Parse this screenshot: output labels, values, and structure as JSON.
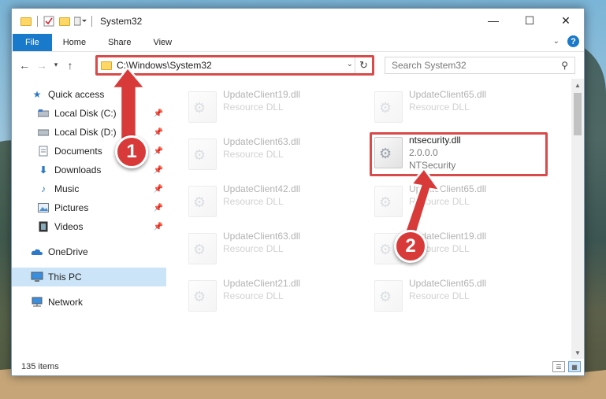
{
  "window": {
    "title": "System32",
    "controls": {
      "minimize": "—",
      "maximize": "☐",
      "close": "✕"
    }
  },
  "ribbon": {
    "tabs": [
      {
        "label": "File"
      },
      {
        "label": "Home"
      },
      {
        "label": "Share"
      },
      {
        "label": "View"
      }
    ]
  },
  "address": {
    "path": "C:\\Windows\\System32",
    "search_placeholder": "Search System32"
  },
  "sidebar": {
    "items": [
      {
        "label": "Quick access",
        "icon": "star-icon"
      },
      {
        "label": "Local Disk (C:)",
        "icon": "drive-icon",
        "pinned": true
      },
      {
        "label": "Local Disk (D:)",
        "icon": "drive-icon",
        "pinned": true
      },
      {
        "label": "Documents",
        "icon": "documents-icon",
        "pinned": true
      },
      {
        "label": "Downloads",
        "icon": "download-icon",
        "pinned": true
      },
      {
        "label": "Music",
        "icon": "music-icon",
        "pinned": true
      },
      {
        "label": "Pictures",
        "icon": "pictures-icon",
        "pinned": true
      },
      {
        "label": "Videos",
        "icon": "videos-icon",
        "pinned": true
      },
      {
        "label": "OneDrive",
        "icon": "cloud-icon"
      },
      {
        "label": "This PC",
        "icon": "computer-icon",
        "selected": true
      },
      {
        "label": "Network",
        "icon": "network-icon"
      }
    ]
  },
  "files": {
    "left": [
      {
        "name": "UpdateClient19.dll",
        "type": "Resource DLL"
      },
      {
        "name": "UpdateClient63.dll",
        "type": "Resource DLL"
      },
      {
        "name": "UpdateClient42.dll",
        "type": "Resource DLL"
      },
      {
        "name": "UpdateClient63.dll",
        "type": "Resource DLL"
      },
      {
        "name": "UpdateClient21.dll",
        "type": "Resource DLL"
      }
    ],
    "right": [
      {
        "name": "UpdateClient65.dll",
        "type": "Resource DLL"
      },
      {
        "name": "ntsecurity.dll",
        "version": "2.0.0.0",
        "company": "NTSecurity"
      },
      {
        "name": "UpdateClient65.dll",
        "type": "Resource DLL"
      },
      {
        "name": "UpdateClient19.dll",
        "type": "Resource DLL"
      },
      {
        "name": "UpdateClient65.dll",
        "type": "Resource DLL"
      }
    ]
  },
  "status": {
    "item_count": "135 items"
  },
  "callouts": {
    "step1": "1",
    "step2": "2"
  },
  "colors": {
    "highlight": "#d94a4a",
    "accent": "#1979ca",
    "badge": "#d83a3a"
  }
}
